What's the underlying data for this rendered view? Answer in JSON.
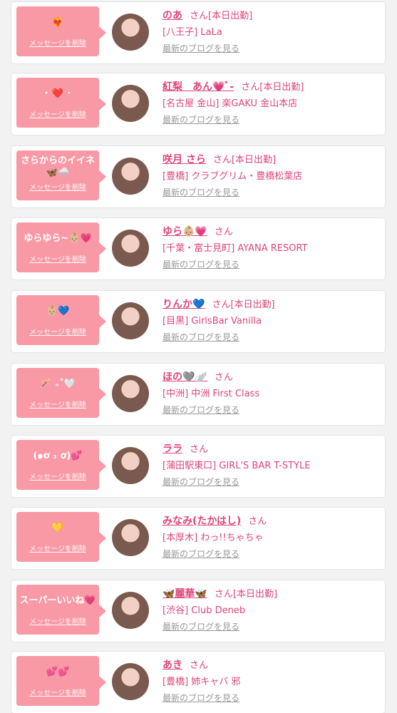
{
  "delete_label": "メッセージを削除",
  "blog_label": "最新のブログを見る",
  "colors": {
    "accent": "#e0457c",
    "bubble": "#f999a6",
    "muted": "#999999",
    "background": "#f2f2f2"
  },
  "cards": [
    {
      "message": "❤️‍🔥",
      "name": "のあ",
      "suffix": "さん",
      "status": "[本日出勤]",
      "shop": "[八王子] LaLa"
    },
    {
      "message": "･ ❤️ ･",
      "name": "紅梨　あん💗ﾞ-",
      "suffix": "さん",
      "status": "[本日出勤]",
      "shop": "[名古屋 金山] 楽GAKU 金山本店"
    },
    {
      "message": "さらからのイイネ🦋🌨️",
      "name": "咲月 さら",
      "suffix": "さん",
      "status": "[本日出勤]",
      "shop": "[豊橋] クラブグリム・豊橋松葉店"
    },
    {
      "message": "ゆらゆら~👶🏼💗",
      "name": "ゆら👶🏼💗",
      "suffix": "さん",
      "status": "",
      "shop": "[千葉・富士見町] AYANA RESORT"
    },
    {
      "message": "👶🏼💙",
      "name": "りんか💙",
      "suffix": "さん",
      "status": "[本日出勤]",
      "shop": "[目黒] GirlsBar Vanilla"
    },
    {
      "message": "🪄 ₊˚🤍",
      "name": "ほの🩶🪽",
      "suffix": "さん",
      "status": "",
      "shop": "[中洲] 中洲 First Class"
    },
    {
      "message": "(๑ơ ₃ ơ)💕",
      "name": "ララ",
      "suffix": "さん",
      "status": "",
      "shop": "[蒲田駅東口] GIRL'S BAR T-STYLE"
    },
    {
      "message": "💛",
      "name": "みなみ(たかはし)",
      "suffix": "さん",
      "status": "",
      "shop": "[本厚木] わっ!!ちゃちゃ"
    },
    {
      "message": "スーパーいいね💗",
      "name": "🦋麗華🦋",
      "suffix": "さん",
      "status": "[本日出勤]",
      "shop": "[渋谷] Club Deneb"
    },
    {
      "message": "💕💕",
      "name": "あき",
      "suffix": "さん",
      "status": "",
      "shop": "[豊橋] 姉キャバ 邪"
    }
  ]
}
